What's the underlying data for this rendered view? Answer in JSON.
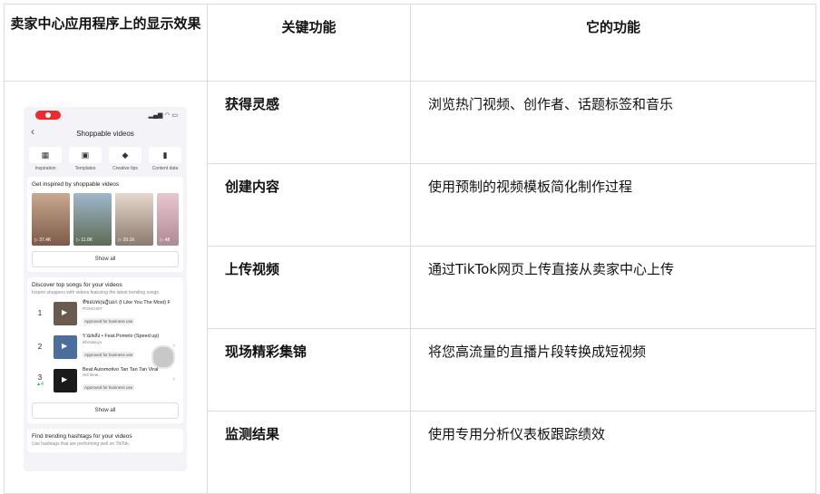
{
  "headers": [
    "卖家中心应用程序上的显示效果",
    "关键功能",
    "它的功能"
  ],
  "rows": [
    {
      "feature": "获得灵感",
      "description": "浏览热门视频、创作者、话题标签和音乐"
    },
    {
      "feature": "创建内容",
      "description": "使用预制的视频模板简化制作过程"
    },
    {
      "feature": "上传视频",
      "description": "通过TikTok网页上传直接从卖家中心上传"
    },
    {
      "feature": "现场精彩集锦",
      "description": "将您高流量的直播片段转换成短视频"
    },
    {
      "feature": "监测结果",
      "description": "使用专用分析仪表板跟踪绩效"
    }
  ],
  "phone": {
    "status_icons": "▂▄▆ ◠ ▭",
    "back": "‹",
    "title": "Shoppable videos",
    "tools": [
      {
        "icon": "film-icon",
        "glyph": "▦",
        "label": "Inspiration"
      },
      {
        "icon": "template-icon",
        "glyph": "▣",
        "label": "Templates"
      },
      {
        "icon": "grad-cap-icon",
        "glyph": "◆",
        "label": "Creative tips"
      },
      {
        "icon": "bar-chart-icon",
        "glyph": "▮",
        "label": "Content data"
      }
    ],
    "inspired": {
      "title": "Get inspired by shoppable videos",
      "videos": [
        "▷ 37.4K",
        "▷ 11.8K",
        "▷ 39.1K",
        "▷ 48"
      ],
      "show_all": "Show all"
    },
    "songs": {
      "title": "Discover top songs for your videos",
      "subtitle": "Inspire shoppers with videos featuring the latest trending songs.",
      "items": [
        {
          "rank": "1",
          "change": "",
          "name": "ที่ชอบทฤษฎีบอก (I Like You The Most) F",
          "artist": "PONCHET",
          "badge": "Approved for business use"
        },
        {
          "rank": "2",
          "change": "",
          "name": "รวมพลัง • Feat.Pomelo (Speed up)",
          "artist": "Bhinabuyo",
          "badge": "Approved for business use"
        },
        {
          "rank": "3",
          "change": "▲4",
          "name": "Beat Automotivo Tan Tan Tan Viral",
          "artist": "WZ Beat",
          "badge": "Approved for business use"
        }
      ],
      "show_all": "Show all"
    },
    "hashtags": {
      "title": "Find trending hashtags for your videos",
      "subtitle": "Use hashtags that are performing well on TikTok."
    }
  }
}
